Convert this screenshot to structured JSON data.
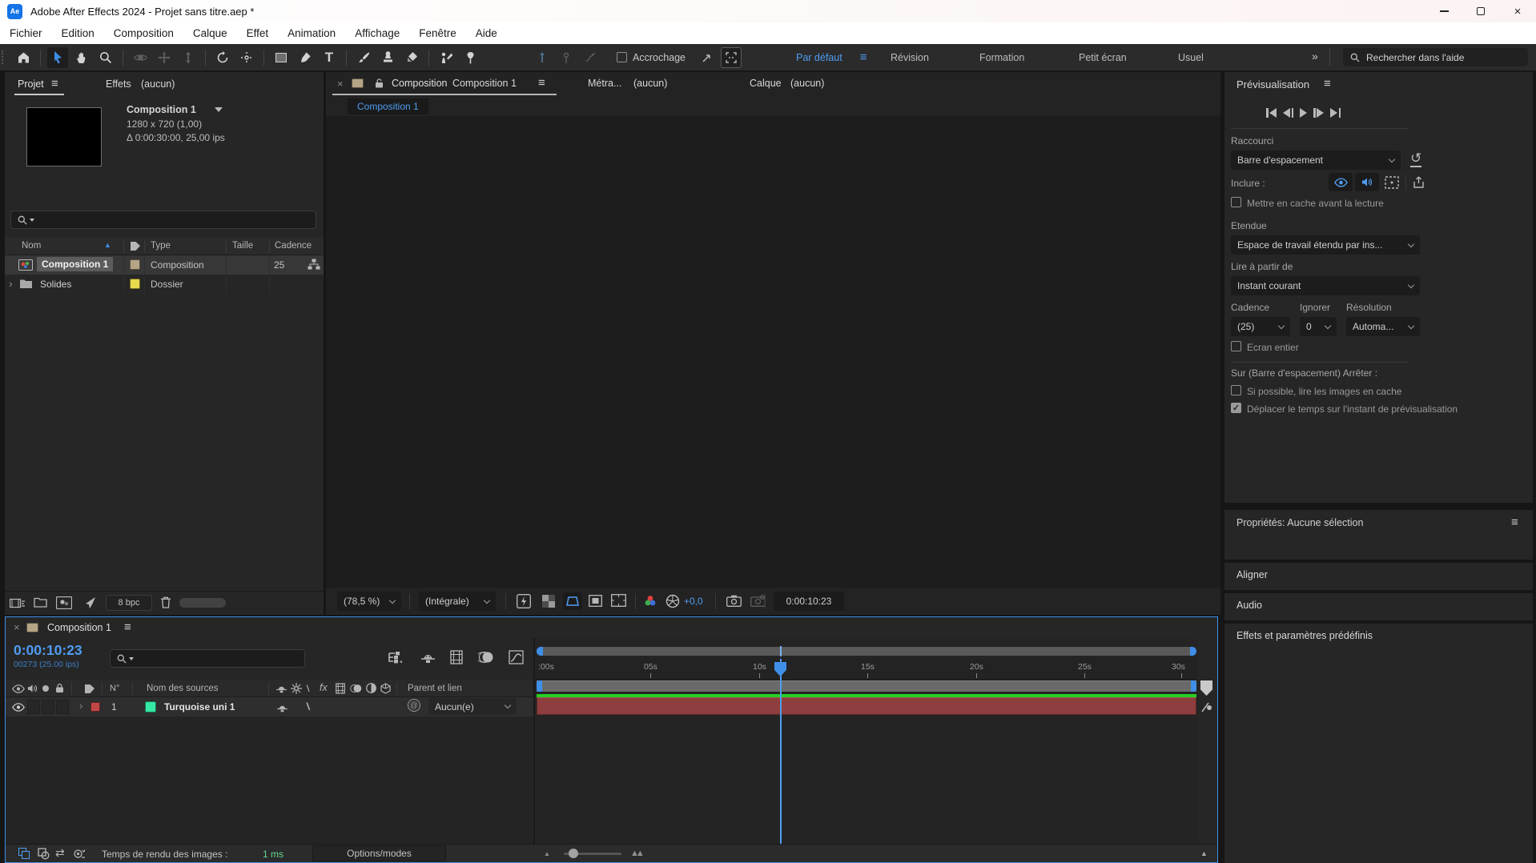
{
  "window": {
    "app_initials": "Ae",
    "title": "Adobe After Effects 2024 - Projet sans titre.aep *"
  },
  "menubar": {
    "items": [
      "Fichier",
      "Edition",
      "Composition",
      "Calque",
      "Effet",
      "Animation",
      "Affichage",
      "Fenêtre",
      "Aide"
    ]
  },
  "toolbar": {
    "snap_label": "Accrochage",
    "workspaces": [
      "Par défaut",
      "Révision",
      "Formation",
      "Petit écran",
      "Usuel"
    ],
    "active_workspace": "Par défaut",
    "help_search_placeholder": "Rechercher dans l'aide"
  },
  "project": {
    "tab_label": "Projet",
    "effects_tab_label": "Effets",
    "effects_tab_suffix": "(aucun)",
    "selected_item": {
      "name": "Composition 1",
      "dimensions": "1280 x 720 (1,00)",
      "duration_fps": "Δ 0:00:30:00, 25,00 ips"
    },
    "table": {
      "headers": {
        "name": "Nom",
        "type": "Type",
        "size": "Taille",
        "rate": "Cadence"
      },
      "rows": [
        {
          "name": "Composition 1",
          "type": "Composition",
          "rate": "25",
          "label_color": "#b5a486"
        },
        {
          "name": "Solides",
          "type": "Dossier",
          "rate": "",
          "label_color": "#e8d94e"
        }
      ]
    },
    "bit_depth": "8 bpc"
  },
  "viewer": {
    "tab_prefix": "Composition",
    "tab_name": "Composition 1",
    "footage_tab": "Métra...",
    "footage_suffix": "(aucun)",
    "layer_tab": "Calque",
    "layer_suffix": "(aucun)",
    "subtab": "Composition 1",
    "zoom_value": "(78,5 %)",
    "resolution_value": "(Intégrale)",
    "exposure_value": "+0,0",
    "timecode": "0:00:10:23"
  },
  "preview": {
    "title": "Prévisualisation",
    "shortcut_label": "Raccourci",
    "shortcut_value": "Barre d'espacement",
    "include_label": "Inclure :",
    "cache_before_label": "Mettre en cache avant la lecture",
    "range_label": "Etendue",
    "range_value": "Espace de travail étendu par ins...",
    "play_from_label": "Lire à partir de",
    "play_from_value": "Instant courant",
    "rate_label": "Cadence",
    "skip_label": "Ignorer",
    "resolution_label": "Résolution",
    "rate_value": "(25)",
    "skip_value": "0",
    "resolution_value": "Automa...",
    "fullscreen_label": "Ecran entier",
    "on_stop_label": "Sur (Barre d'espacement) Arrêter :",
    "cache_play_label": "Si possible, lire les images en cache",
    "move_time_label": "Déplacer le temps sur l'instant de prévisualisation"
  },
  "side_panels": {
    "properties": "Propriétés: Aucune sélection",
    "align": "Aligner",
    "audio": "Audio",
    "effects": "Effets et paramètres prédéfinis"
  },
  "timeline": {
    "tab_name": "Composition 1",
    "timecode": "0:00:10:23",
    "frame_info": "00273 (25.00 ips)",
    "columns": {
      "number": "N°",
      "source_name": "Nom des sources",
      "parent": "Parent et lien"
    },
    "layers": [
      {
        "index": "1",
        "name": "Turquoise uni 1",
        "parent_value": "Aucun(e)",
        "label_color": "#c14747",
        "source_color": "#35e8a4"
      }
    ],
    "ruler_labels": [
      ":00s",
      "05s",
      "10s",
      "15s",
      "20s",
      "25s",
      "30s"
    ],
    "status": {
      "render_time_label": "Temps de rendu des images :",
      "render_time_value": "1 ms",
      "options_label": "Options/modes"
    }
  },
  "glyphs": {
    "close": "×",
    "menu": "≡",
    "overflow": "»",
    "sort": "▲",
    "expand": "›",
    "reset": "↺",
    "swap": "⇄",
    "at": "@",
    "fx": "fx",
    "backslash": "\\",
    "check": "✓",
    "mountain_small": "▲",
    "mountain_large": "▲▲",
    "caret_up": "▲"
  },
  "colors": {
    "accent_blue": "#3f8fe8",
    "timecode_blue": "#4f9df2",
    "render_green": "#25cf25",
    "layer_bar_red": "#8e3e3e",
    "render_ms_green": "#62d98f"
  }
}
